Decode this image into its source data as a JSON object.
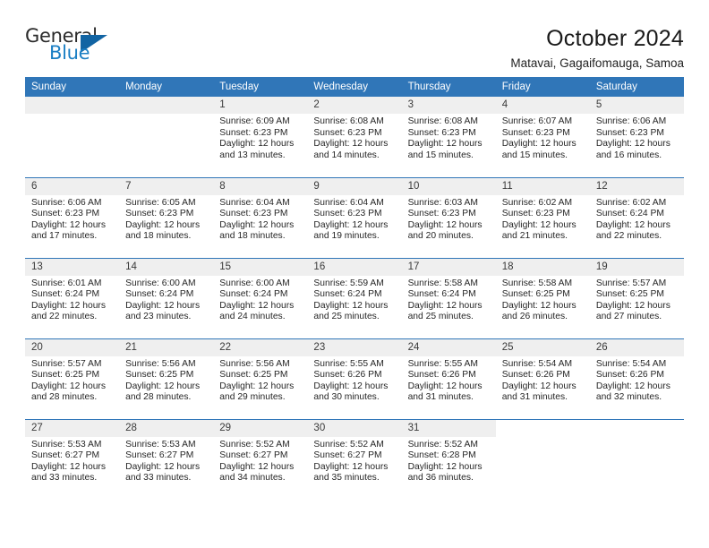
{
  "logo": {
    "word_one": "General",
    "word_two": "Blue",
    "triangle": "triangle-mark",
    "accent_dark": "#2b2b2b",
    "accent_blue": "#1b7fc4"
  },
  "header": {
    "title": "October 2024",
    "subtitle": "Matavai, Gagaifomauga, Samoa"
  },
  "theme": {
    "header_blue": "#3076b8",
    "daynum_gray": "#efefef",
    "text": "#262626"
  },
  "weekdays": [
    "Sunday",
    "Monday",
    "Tuesday",
    "Wednesday",
    "Thursday",
    "Friday",
    "Saturday"
  ],
  "weeks": [
    [
      {
        "day": "",
        "sunrise": "",
        "sunset": "",
        "daylight_1": "",
        "daylight_2": "",
        "state": "empty"
      },
      {
        "day": "",
        "sunrise": "",
        "sunset": "",
        "daylight_1": "",
        "daylight_2": "",
        "state": "empty"
      },
      {
        "day": "1",
        "sunrise": "Sunrise: 6:09 AM",
        "sunset": "Sunset: 6:23 PM",
        "daylight_1": "Daylight: 12 hours",
        "daylight_2": "and 13 minutes.",
        "state": "filled"
      },
      {
        "day": "2",
        "sunrise": "Sunrise: 6:08 AM",
        "sunset": "Sunset: 6:23 PM",
        "daylight_1": "Daylight: 12 hours",
        "daylight_2": "and 14 minutes.",
        "state": "filled"
      },
      {
        "day": "3",
        "sunrise": "Sunrise: 6:08 AM",
        "sunset": "Sunset: 6:23 PM",
        "daylight_1": "Daylight: 12 hours",
        "daylight_2": "and 15 minutes.",
        "state": "filled"
      },
      {
        "day": "4",
        "sunrise": "Sunrise: 6:07 AM",
        "sunset": "Sunset: 6:23 PM",
        "daylight_1": "Daylight: 12 hours",
        "daylight_2": "and 15 minutes.",
        "state": "filled"
      },
      {
        "day": "5",
        "sunrise": "Sunrise: 6:06 AM",
        "sunset": "Sunset: 6:23 PM",
        "daylight_1": "Daylight: 12 hours",
        "daylight_2": "and 16 minutes.",
        "state": "filled"
      }
    ],
    [
      {
        "day": "6",
        "sunrise": "Sunrise: 6:06 AM",
        "sunset": "Sunset: 6:23 PM",
        "daylight_1": "Daylight: 12 hours",
        "daylight_2": "and 17 minutes.",
        "state": "filled"
      },
      {
        "day": "7",
        "sunrise": "Sunrise: 6:05 AM",
        "sunset": "Sunset: 6:23 PM",
        "daylight_1": "Daylight: 12 hours",
        "daylight_2": "and 18 minutes.",
        "state": "filled"
      },
      {
        "day": "8",
        "sunrise": "Sunrise: 6:04 AM",
        "sunset": "Sunset: 6:23 PM",
        "daylight_1": "Daylight: 12 hours",
        "daylight_2": "and 18 minutes.",
        "state": "filled"
      },
      {
        "day": "9",
        "sunrise": "Sunrise: 6:04 AM",
        "sunset": "Sunset: 6:23 PM",
        "daylight_1": "Daylight: 12 hours",
        "daylight_2": "and 19 minutes.",
        "state": "filled"
      },
      {
        "day": "10",
        "sunrise": "Sunrise: 6:03 AM",
        "sunset": "Sunset: 6:23 PM",
        "daylight_1": "Daylight: 12 hours",
        "daylight_2": "and 20 minutes.",
        "state": "filled"
      },
      {
        "day": "11",
        "sunrise": "Sunrise: 6:02 AM",
        "sunset": "Sunset: 6:23 PM",
        "daylight_1": "Daylight: 12 hours",
        "daylight_2": "and 21 minutes.",
        "state": "filled"
      },
      {
        "day": "12",
        "sunrise": "Sunrise: 6:02 AM",
        "sunset": "Sunset: 6:24 PM",
        "daylight_1": "Daylight: 12 hours",
        "daylight_2": "and 22 minutes.",
        "state": "filled"
      }
    ],
    [
      {
        "day": "13",
        "sunrise": "Sunrise: 6:01 AM",
        "sunset": "Sunset: 6:24 PM",
        "daylight_1": "Daylight: 12 hours",
        "daylight_2": "and 22 minutes.",
        "state": "filled"
      },
      {
        "day": "14",
        "sunrise": "Sunrise: 6:00 AM",
        "sunset": "Sunset: 6:24 PM",
        "daylight_1": "Daylight: 12 hours",
        "daylight_2": "and 23 minutes.",
        "state": "filled"
      },
      {
        "day": "15",
        "sunrise": "Sunrise: 6:00 AM",
        "sunset": "Sunset: 6:24 PM",
        "daylight_1": "Daylight: 12 hours",
        "daylight_2": "and 24 minutes.",
        "state": "filled"
      },
      {
        "day": "16",
        "sunrise": "Sunrise: 5:59 AM",
        "sunset": "Sunset: 6:24 PM",
        "daylight_1": "Daylight: 12 hours",
        "daylight_2": "and 25 minutes.",
        "state": "filled"
      },
      {
        "day": "17",
        "sunrise": "Sunrise: 5:58 AM",
        "sunset": "Sunset: 6:24 PM",
        "daylight_1": "Daylight: 12 hours",
        "daylight_2": "and 25 minutes.",
        "state": "filled"
      },
      {
        "day": "18",
        "sunrise": "Sunrise: 5:58 AM",
        "sunset": "Sunset: 6:25 PM",
        "daylight_1": "Daylight: 12 hours",
        "daylight_2": "and 26 minutes.",
        "state": "filled"
      },
      {
        "day": "19",
        "sunrise": "Sunrise: 5:57 AM",
        "sunset": "Sunset: 6:25 PM",
        "daylight_1": "Daylight: 12 hours",
        "daylight_2": "and 27 minutes.",
        "state": "filled"
      }
    ],
    [
      {
        "day": "20",
        "sunrise": "Sunrise: 5:57 AM",
        "sunset": "Sunset: 6:25 PM",
        "daylight_1": "Daylight: 12 hours",
        "daylight_2": "and 28 minutes.",
        "state": "filled"
      },
      {
        "day": "21",
        "sunrise": "Sunrise: 5:56 AM",
        "sunset": "Sunset: 6:25 PM",
        "daylight_1": "Daylight: 12 hours",
        "daylight_2": "and 28 minutes.",
        "state": "filled"
      },
      {
        "day": "22",
        "sunrise": "Sunrise: 5:56 AM",
        "sunset": "Sunset: 6:25 PM",
        "daylight_1": "Daylight: 12 hours",
        "daylight_2": "and 29 minutes.",
        "state": "filled"
      },
      {
        "day": "23",
        "sunrise": "Sunrise: 5:55 AM",
        "sunset": "Sunset: 6:26 PM",
        "daylight_1": "Daylight: 12 hours",
        "daylight_2": "and 30 minutes.",
        "state": "filled"
      },
      {
        "day": "24",
        "sunrise": "Sunrise: 5:55 AM",
        "sunset": "Sunset: 6:26 PM",
        "daylight_1": "Daylight: 12 hours",
        "daylight_2": "and 31 minutes.",
        "state": "filled"
      },
      {
        "day": "25",
        "sunrise": "Sunrise: 5:54 AM",
        "sunset": "Sunset: 6:26 PM",
        "daylight_1": "Daylight: 12 hours",
        "daylight_2": "and 31 minutes.",
        "state": "filled"
      },
      {
        "day": "26",
        "sunrise": "Sunrise: 5:54 AM",
        "sunset": "Sunset: 6:26 PM",
        "daylight_1": "Daylight: 12 hours",
        "daylight_2": "and 32 minutes.",
        "state": "filled"
      }
    ],
    [
      {
        "day": "27",
        "sunrise": "Sunrise: 5:53 AM",
        "sunset": "Sunset: 6:27 PM",
        "daylight_1": "Daylight: 12 hours",
        "daylight_2": "and 33 minutes.",
        "state": "filled"
      },
      {
        "day": "28",
        "sunrise": "Sunrise: 5:53 AM",
        "sunset": "Sunset: 6:27 PM",
        "daylight_1": "Daylight: 12 hours",
        "daylight_2": "and 33 minutes.",
        "state": "filled"
      },
      {
        "day": "29",
        "sunrise": "Sunrise: 5:52 AM",
        "sunset": "Sunset: 6:27 PM",
        "daylight_1": "Daylight: 12 hours",
        "daylight_2": "and 34 minutes.",
        "state": "filled"
      },
      {
        "day": "30",
        "sunrise": "Sunrise: 5:52 AM",
        "sunset": "Sunset: 6:27 PM",
        "daylight_1": "Daylight: 12 hours",
        "daylight_2": "and 35 minutes.",
        "state": "filled"
      },
      {
        "day": "31",
        "sunrise": "Sunrise: 5:52 AM",
        "sunset": "Sunset: 6:28 PM",
        "daylight_1": "Daylight: 12 hours",
        "daylight_2": "and 36 minutes.",
        "state": "filled"
      },
      {
        "day": "",
        "sunrise": "",
        "sunset": "",
        "daylight_1": "",
        "daylight_2": "",
        "state": "blank"
      },
      {
        "day": "",
        "sunrise": "",
        "sunset": "",
        "daylight_1": "",
        "daylight_2": "",
        "state": "blank"
      }
    ]
  ]
}
